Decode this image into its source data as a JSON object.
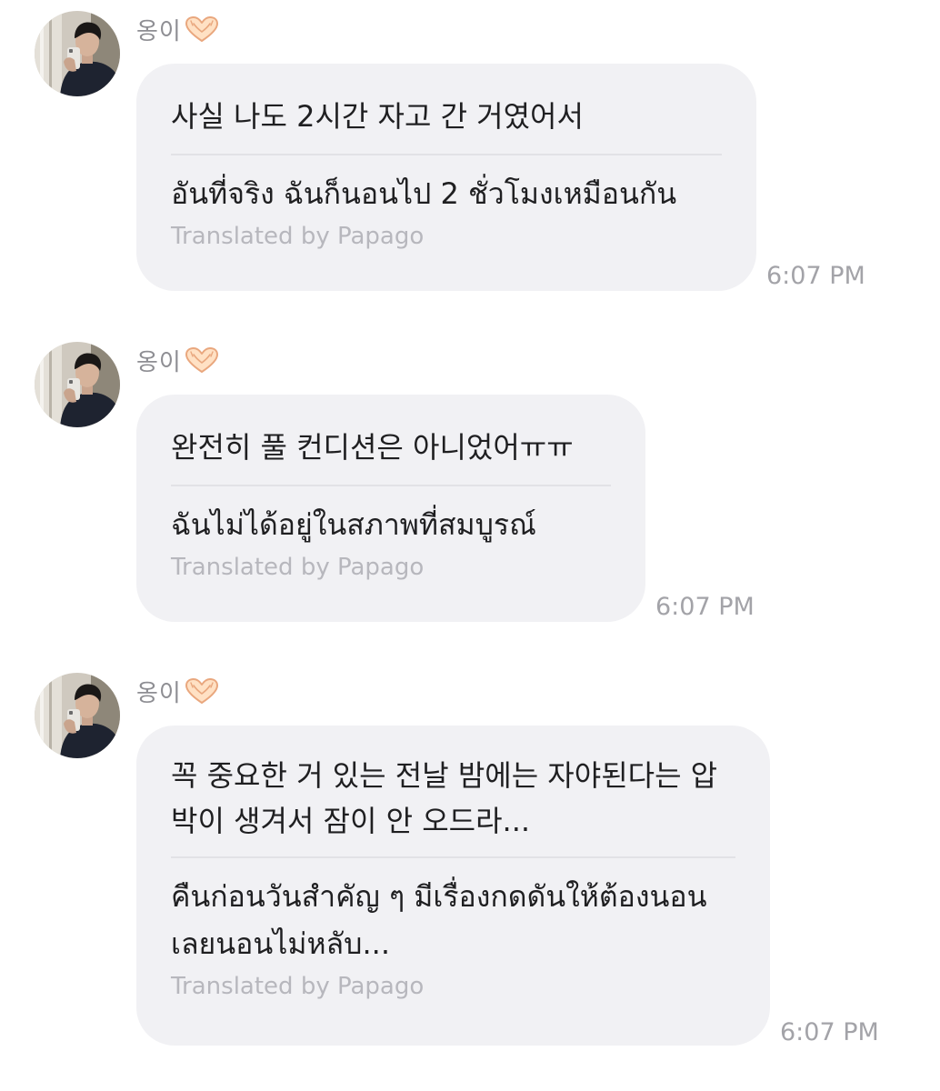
{
  "colors": {
    "background": "#ffffff",
    "bubble": "#f1f1f4",
    "message_text": "#1f1f21",
    "credit_text": "#b7b7bd",
    "meta_text": "#8e8e93",
    "divider": "#e2e2e6"
  },
  "messages": [
    {
      "sender": "옹이",
      "sender_emoji": "heart-hands-icon",
      "original": "사실 나도 2시간 자고 간 거였어서",
      "translation": "อันที่จริง ฉันก็นอนไป 2 ชั่วโมงเหมือนกัน",
      "credit": "Translated by Papago",
      "time": "6:07 PM"
    },
    {
      "sender": "옹이",
      "sender_emoji": "heart-hands-icon",
      "original": "완전히 풀 컨디션은 아니었어ㅠㅠ",
      "translation": "ฉันไม่ได้อยู่ในสภาพที่สมบูรณ์",
      "credit": "Translated by Papago",
      "time": "6:07 PM"
    },
    {
      "sender": "옹이",
      "sender_emoji": "heart-hands-icon",
      "original": "꼭 중요한 거 있는 전날 밤에는 자야된다는 압박이 생겨서 잠이 안 오드라...",
      "translation": "คืนก่อนวันสำคัญ ๆ มีเรื่องกดดันให้ต้องนอน เลยนอนไม่หลับ...",
      "credit": "Translated by Papago",
      "time": "6:07 PM"
    }
  ]
}
